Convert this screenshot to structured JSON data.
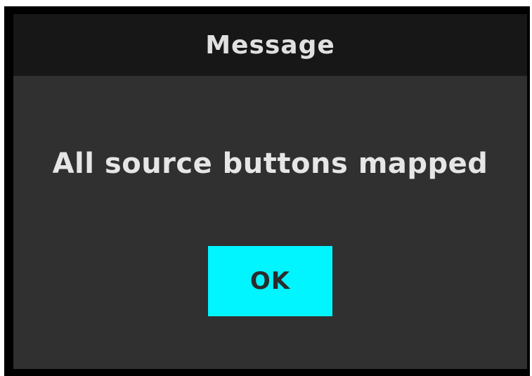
{
  "dialog": {
    "title": "Message",
    "message": "All source buttons mapped",
    "ok_label": "OK"
  },
  "colors": {
    "title_bar": "#171717",
    "dialog_bg": "#303030",
    "button_bg": "#00f5ff",
    "text_light": "#e6e6e6",
    "text_dark": "#2b2b2b"
  }
}
